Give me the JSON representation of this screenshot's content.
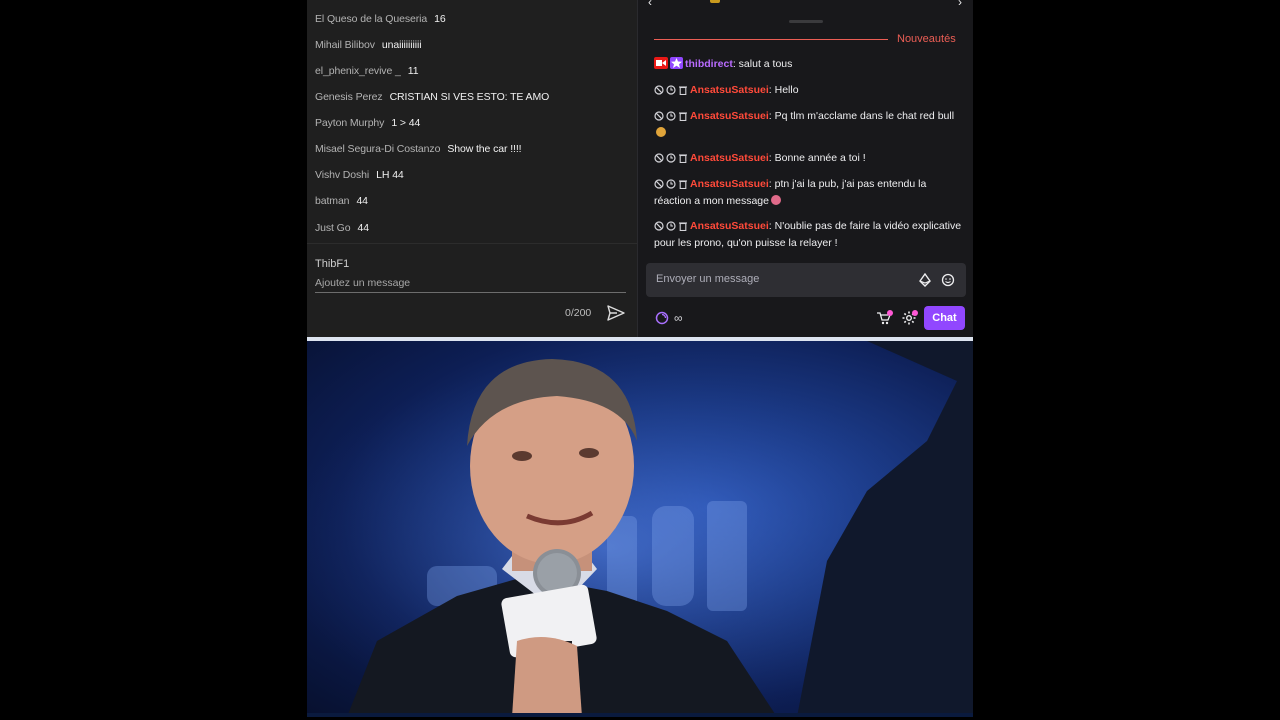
{
  "youtube_chat": {
    "messages": [
      {
        "author": "El Queso de la Queseria",
        "text": "16"
      },
      {
        "author": "Mihail Bilibov",
        "text": "unaiiiiiiiiii"
      },
      {
        "author": "el_phenix_revive _",
        "text": "11"
      },
      {
        "author": "Genesis Perez",
        "text": "CRISTIAN SI VES ESTO: TE AMO"
      },
      {
        "author": "Payton Murphy",
        "text": "1 > 44"
      },
      {
        "author": "Misael Segura-Di Costanzo",
        "text": "Show the car !!!!"
      },
      {
        "author": "Vishv Doshi",
        "text": "LH 44"
      },
      {
        "author": "batman",
        "text": "44"
      },
      {
        "author": "Just Go",
        "text": "44"
      }
    ],
    "current_user": "ThibF1",
    "input_placeholder": "Ajoutez un message",
    "char_counter": "0/200",
    "icons": {
      "send": "send-icon"
    }
  },
  "twitch_chat": {
    "new_messages_label": "Nouveautés",
    "messages": [
      {
        "badges": [
          "broadcaster-badge",
          "vip-star-badge"
        ],
        "author": "thibdirect",
        "author_color": "#b96bff",
        "text": ": salut a tous",
        "mod_icons": false
      },
      {
        "author": "AnsatsuSatsuei",
        "author_color": "#ff4a3a",
        "text": ": Hello",
        "mod_icons": true
      },
      {
        "author": "AnsatsuSatsuei",
        "author_color": "#ff4a3a",
        "text": ": Pq tlm m'acclame dans le chat red bull",
        "emoji": "face-emoji",
        "mod_icons": true
      },
      {
        "author": "AnsatsuSatsuei",
        "author_color": "#ff4a3a",
        "text": ": Bonne année a toi !",
        "mod_icons": true
      },
      {
        "author": "AnsatsuSatsuei",
        "author_color": "#ff4a3a",
        "text": ": ptn j'ai la pub, j'ai pas entendu la réaction a mon message",
        "emoji": "face-emoji",
        "mod_icons": true
      },
      {
        "author": "AnsatsuSatsuei",
        "author_color": "#ff4a3a",
        "text": ": N'oublie pas de faire la vidéo explicative pour les prono, qu'on puisse la relayer !",
        "mod_icons": true
      }
    ],
    "input_placeholder": "Envoyer un message",
    "channel_points": "∞",
    "chat_button_label": "Chat",
    "colors": {
      "accent": "#9147ff",
      "new_divider": "#eb5e55",
      "panel_bg": "#18181b"
    },
    "icons": {
      "ban": "ban-icon",
      "timeout": "timeout-icon",
      "delete": "trash-icon",
      "bits": "bits-icon",
      "emote": "emote-icon",
      "points": "channel-points-icon",
      "cart": "cart-icon",
      "settings": "gear-icon"
    }
  },
  "video": {
    "description_label": "live stream video frame"
  }
}
